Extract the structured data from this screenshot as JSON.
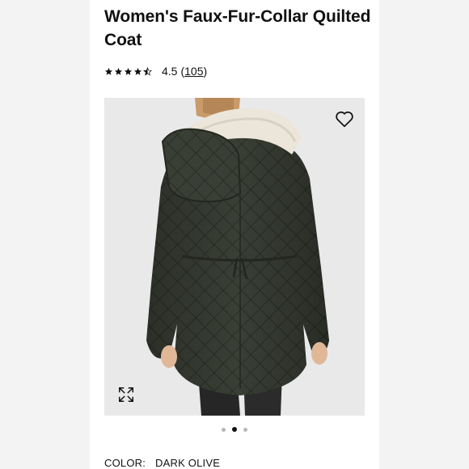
{
  "product": {
    "title": "Women's Faux-Fur-Collar Quilted Coat",
    "rating": {
      "stars": 4.5,
      "value_label": "4.5",
      "open_paren": "(",
      "count": "105",
      "close_paren": ")"
    }
  },
  "icons": {
    "wishlist": "heart-icon",
    "expand": "expand-icon",
    "star": "star-icon"
  },
  "carousel": {
    "total": 3,
    "active_index": 1
  },
  "color": {
    "label": "COLOR:",
    "value": "DARK OLIVE"
  },
  "colors": {
    "coat": "#3a3f35",
    "collar": "#ece6da",
    "background": "#e9e9ea"
  }
}
